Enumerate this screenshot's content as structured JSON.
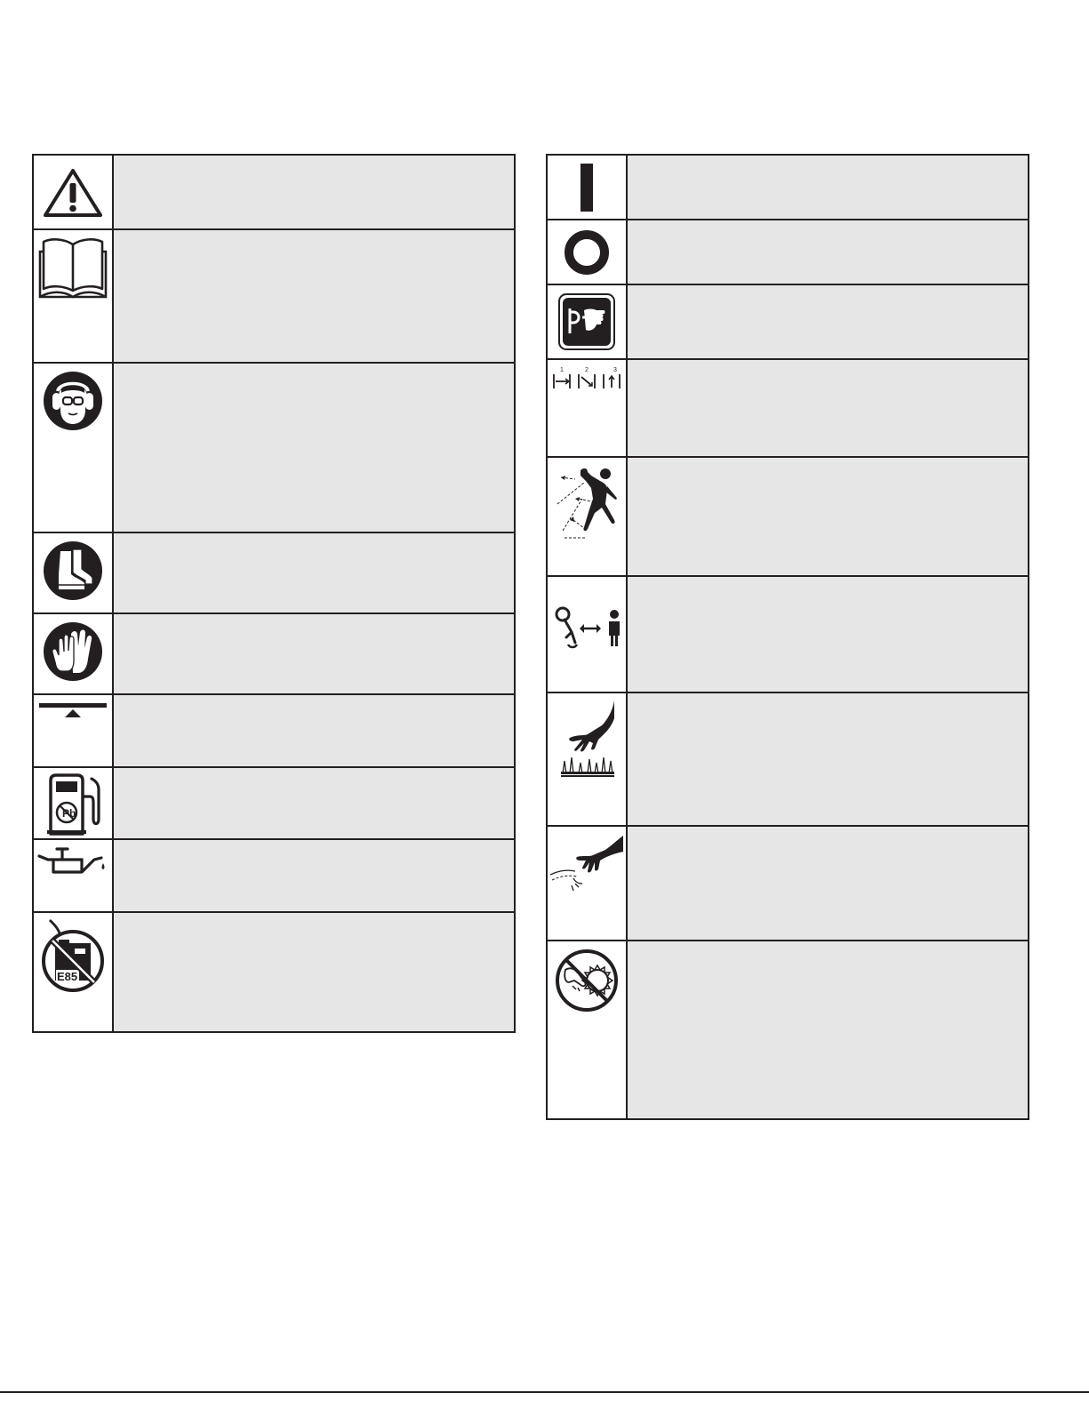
{
  "left_symbols": [
    {
      "icon": "safety-alert-icon"
    },
    {
      "icon": "read-manual-icon"
    },
    {
      "icon": "eye-ear-protection-icon"
    },
    {
      "icon": "safety-boots-icon"
    },
    {
      "icon": "gloves-icon"
    },
    {
      "icon": "choke-icon"
    },
    {
      "icon": "unleaded-fuel-icon"
    },
    {
      "icon": "oil-can-icon"
    },
    {
      "icon": "no-e85-fuel-icon"
    }
  ],
  "right_symbols": [
    {
      "icon": "on-start-icon",
      "glyph": "I"
    },
    {
      "icon": "off-stop-icon",
      "glyph": "O"
    },
    {
      "icon": "primer-bulb-icon"
    },
    {
      "icon": "pull-starter-steps-icon",
      "step_labels": [
        "1",
        "2",
        "3"
      ]
    },
    {
      "icon": "thrown-objects-icon"
    },
    {
      "icon": "keep-bystanders-away-icon"
    },
    {
      "icon": "hot-surface-icon"
    },
    {
      "icon": "rotating-line-icon"
    },
    {
      "icon": "no-blade-icon"
    }
  ],
  "colors": {
    "ink": "#231f20",
    "cell_fill": "#e6e6e6",
    "icon_fill": "#ffffff"
  }
}
